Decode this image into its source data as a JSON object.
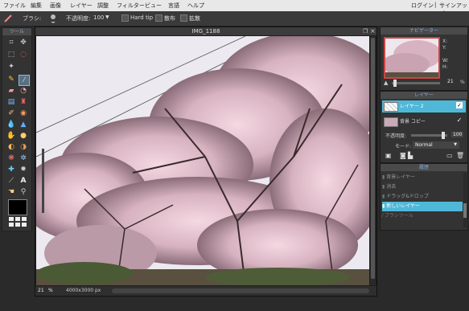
{
  "menubar": {
    "items": [
      "ファイル",
      "編集",
      "画像",
      "レイヤー",
      "調整",
      "フィルター",
      "ビュー",
      "言語",
      "ヘルプ"
    ],
    "login": "ログイン",
    "signup": "サインアップ"
  },
  "toolbar": {
    "brush_label": "ブラシ:",
    "opacity_label": "不透明度:",
    "opacity_value": "100",
    "hardtip": "Hard tip",
    "scatter": "散布",
    "spread": "拡散"
  },
  "tools_title": "ツール",
  "canvas": {
    "title": "IMG_1188",
    "zoom": "21",
    "zoom_unit": "%",
    "size": "4000x3000 px"
  },
  "navigator": {
    "title": "ナビゲーター",
    "x_label": "X:",
    "y_label": "Y:",
    "w_label": "W:",
    "h_label": "H:",
    "zoom_value": "21",
    "zoom_unit": "%"
  },
  "layers": {
    "title": "レイヤー",
    "items": [
      {
        "name": "レイヤー 2",
        "selected": true
      },
      {
        "name": "背景 コピー",
        "selected": false
      }
    ],
    "opacity_label": "不透明度:",
    "opacity_value": "100",
    "mode_label": "モード:",
    "mode_value": "Normal"
  },
  "history": {
    "title": "履歴",
    "items": [
      "背景レイヤー",
      "消去",
      "ドラッグ&ドロップ",
      "消去",
      "新しいレイヤー",
      "ブラシツール"
    ],
    "selected_index": 4
  },
  "colors": {
    "accent": "#4fb8d8",
    "foreground": "#000000",
    "background": "#ffffff"
  }
}
